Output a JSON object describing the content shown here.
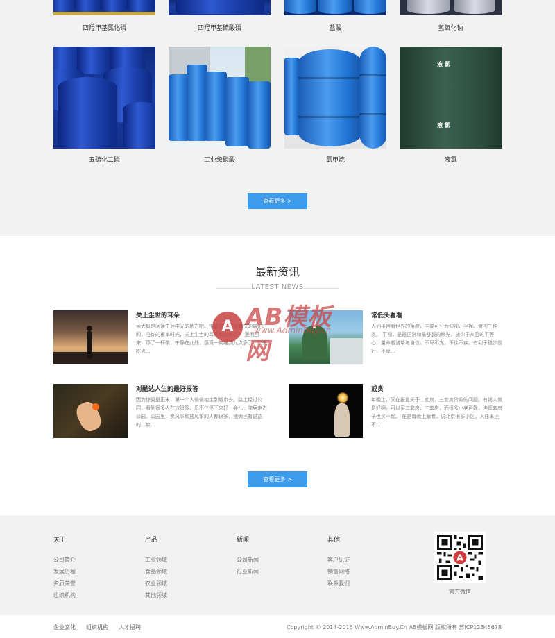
{
  "products": {
    "row1": [
      "四羟甲基氯化磷",
      "四羟甲基硫酸磷",
      "盐酸",
      "氢氧化钠"
    ],
    "row2": [
      "五硫化二磷",
      "工业级磷酸",
      "氯甲烷",
      "液氯"
    ],
    "more_label": "查看更多 >"
  },
  "news": {
    "title": "最新资讯",
    "subtitle": "LATEST NEWS",
    "items": [
      {
        "title": "关上尘世的耳朵",
        "text": "读大概是阅读生涯中光的地方吧。生活节奏越来越快的最忙时间，陪你的根本时光，关上尘世的耳朵和这世过。 漫闲回来，停了一杯茶，午静在此处，感慨一笑睡到九点多了！起来吃点..."
      },
      {
        "title": "常低头看看",
        "text": "人们平常看世界的角度，主要可分为仰视、平视、俯视三种类。 平视，是最正常和最舒服的眼光，放你于从容的平等心，量命着诚挚与自信，不卑不亢，不徐不疾，有利于稳步前行，不卑..."
      },
      {
        "title": "对酷达人生的最好报答",
        "text": "因为惊喜是正米，第一个人偷偷地走到城市去。路上经过公园，看到很多人在放风筝，忍不住停下来好一会儿，随后走进公园。公园里，卖风筝和放风筝的人都很多，他俩还有说花的，卖..."
      },
      {
        "title": "戒贪",
        "text": "每晚上，又在报道关于二套房、三套房贷款的问题。有钱人就是好啊，可以买二套房、三套房，而很多小老百姓，连辉套房子也买不起。 在是每晚上跟着，说北京很多小区，入住率还不..."
      }
    ],
    "more_label": "查看更多 >"
  },
  "watermark": {
    "logo": "A",
    "text": "AB模板网",
    "url": "www.AdminBuy.cn"
  },
  "footer": {
    "columns": [
      {
        "head": "关于",
        "links": [
          "公司简介",
          "发展历程",
          "资质荣誉",
          "组织机构"
        ]
      },
      {
        "head": "产品",
        "links": [
          "工业领域",
          "食品领域",
          "农业领域",
          "其他领域"
        ]
      },
      {
        "head": "新闻",
        "links": [
          "公司新闻",
          "行业新闻"
        ]
      },
      {
        "head": "其他",
        "links": [
          "客户见证",
          "销售网络",
          "联系我们"
        ]
      }
    ],
    "qr_caption": "官方微信"
  },
  "bottom": {
    "links": [
      "企业文化",
      "组织机构",
      "人才招聘"
    ],
    "copyright": "Copyright © 2014-2016 Www.AdminBuy.Cn AB模板网 版权所有   苏ICP12345678"
  },
  "tank_labels": [
    "液 氯",
    "液 氯"
  ]
}
